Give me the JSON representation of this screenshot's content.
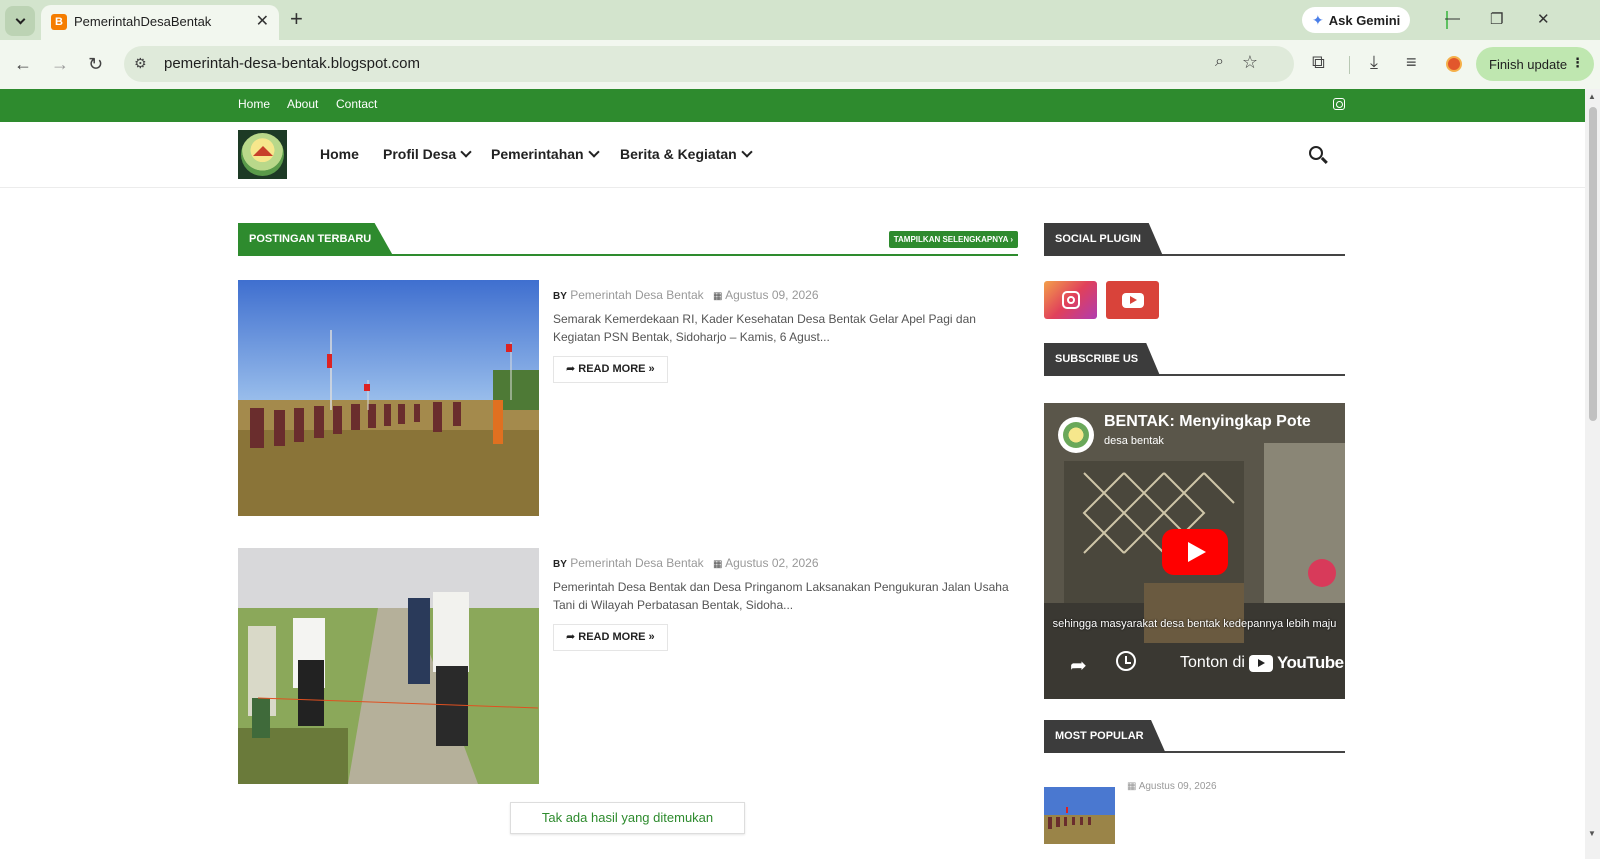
{
  "browser": {
    "tab_title": "PemerintahDesaBentak",
    "favicon": "B",
    "url": "pemerintah-desa-bentak.blogspot.com",
    "ask_gemini": "Ask Gemini",
    "finish_update": "Finish update"
  },
  "topbar": {
    "links": [
      "Home",
      "About",
      "Contact"
    ],
    "social_icon": "instagram-icon"
  },
  "nav": {
    "items": [
      "Home",
      "Profil Desa",
      "Pemerintahan",
      "Berita & Kegiatan"
    ]
  },
  "posts_section": {
    "title": "POSTINGAN TERBARU",
    "show_more": "TAMPILKAN SELENGKAPNYA ›"
  },
  "posts": [
    {
      "by": "BY",
      "author": "Pemerintah Desa Bentak",
      "date": "Agustus 09, 2026",
      "excerpt": "Semarak Kemerdekaan RI, Kader Kesehatan Desa Bentak Gelar Apel Pagi dan Kegiatan PSN Bentak, Sidoharjo – Kamis, 6 Agust...",
      "read_more": "READ MORE »"
    },
    {
      "by": "BY",
      "author": "Pemerintah Desa Bentak",
      "date": "Agustus 02, 2026",
      "excerpt": "Pemerintah Desa Bentak dan Desa Pringanom Laksanakan Pengukuran Jalan Usaha Tani di Wilayah Perbatasan Bentak, Sidoha...",
      "read_more": "READ MORE »"
    }
  ],
  "no_results": "Tak ada hasil yang ditemukan",
  "sidebar": {
    "social_title": "SOCIAL PLUGIN",
    "subscribe_title": "SUBSCRIBE US",
    "popular_title": "MOST POPULAR",
    "video": {
      "title": "BENTAK: Menyingkap Pote",
      "channel": "desa bentak",
      "caption": "sehingga masyarakat desa bentak kedepannya lebih maju",
      "watch_on": "Tonton di",
      "youtube": "YouTube"
    },
    "popular_date": "Agustus 09, 2026"
  },
  "colors": {
    "brand_green": "#2e8b2e",
    "chrome_bg": "#d3e4cd",
    "dark_header": "#3c3c3c"
  }
}
